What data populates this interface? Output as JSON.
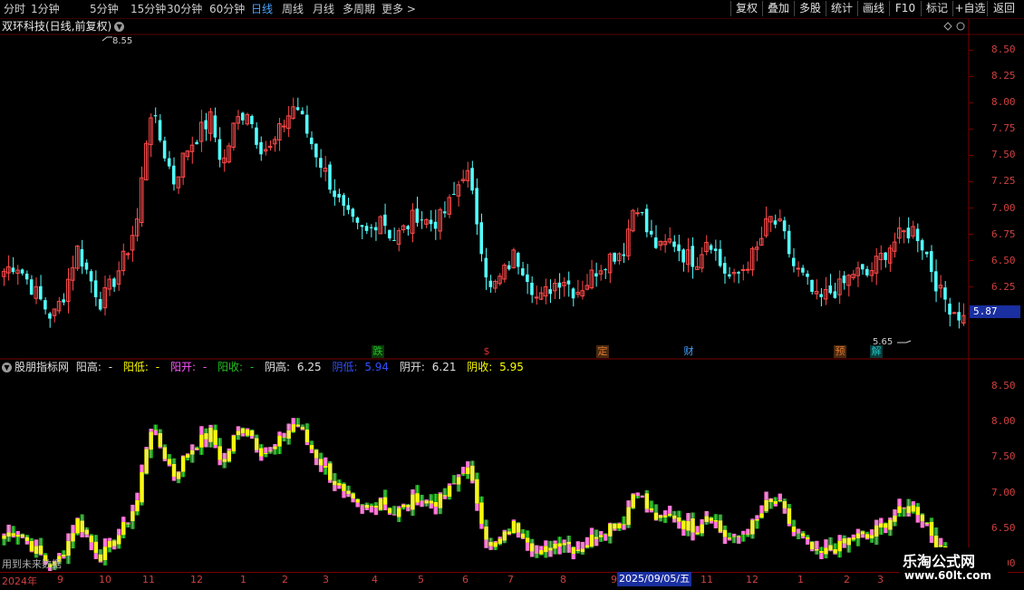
{
  "toolbar": {
    "periods": [
      "分时",
      "1分钟",
      "5分钟",
      "15分钟",
      "30分钟",
      "60分钟",
      "日线",
      "周线",
      "月线",
      "多周期",
      "更多 >"
    ],
    "active_period": "日线",
    "buttons": [
      "复权",
      "叠加",
      "多股",
      "统计",
      "画线",
      "F10",
      "标记",
      "+自选",
      "返回"
    ]
  },
  "main_chart": {
    "title": "双环科技(日线,前复权)",
    "y_ticks": [
      "8.50",
      "8.25",
      "8.00",
      "7.75",
      "7.50",
      "7.25",
      "7.00",
      "6.75",
      "6.50",
      "6.25",
      "6.00"
    ],
    "current_price": "5.87",
    "high_label": "8.55",
    "low_label": "5.65",
    "events": [
      {
        "text": "跌",
        "color": "#22c022"
      },
      {
        "text": "$",
        "color": "#e03030"
      },
      {
        "text": "定",
        "color": "#e07830"
      },
      {
        "text": "财",
        "color": "#4aa3ff"
      },
      {
        "text": "预",
        "color": "#e07830"
      },
      {
        "text": "解",
        "color": "#22c0c0"
      }
    ]
  },
  "indicator": {
    "name": "股朋指标网",
    "items": [
      {
        "label": "阳高:",
        "value": "-",
        "color": "#e0e0e0"
      },
      {
        "label": "阳低:",
        "value": "-",
        "color": "#ffff00"
      },
      {
        "label": "阳开:",
        "value": "-",
        "color": "#ff55ff"
      },
      {
        "label": "阳收:",
        "value": "-",
        "color": "#22c022"
      },
      {
        "label": "阴高:",
        "value": "6.25",
        "color": "#e0e0e0"
      },
      {
        "label": "阴低:",
        "value": "5.94",
        "color": "#3050ff"
      },
      {
        "label": "阴开:",
        "value": "6.21",
        "color": "#e0e0e0"
      },
      {
        "label": "阴收:",
        "value": "5.95",
        "color": "#ffff00"
      }
    ],
    "y_ticks": [
      "8.50",
      "8.00",
      "7.50",
      "7.00",
      "6.50",
      "6.00"
    ],
    "future_note": "用到未来数据"
  },
  "date_axis": {
    "labels": [
      "2024年",
      "9",
      "10",
      "11",
      "12",
      "1",
      "2",
      "3",
      "4",
      "5",
      "6",
      "7",
      "8",
      "9",
      "10",
      "11",
      "12",
      "1",
      "2",
      "3"
    ],
    "highlight": "2025/09/05/五"
  },
  "watermark": {
    "line1": "乐淘公式网",
    "line2": "www.60lt.com"
  },
  "chart_data": {
    "type": "candlestick",
    "title": "双环科技(日线,前复权)",
    "series_close": [
      6.4,
      6.48,
      6.3,
      6.12,
      5.95,
      6.2,
      6.62,
      6.35,
      6.1,
      6.3,
      6.55,
      6.9,
      7.95,
      7.6,
      7.25,
      7.55,
      7.7,
      7.85,
      7.4,
      7.8,
      7.95,
      7.6,
      7.55,
      7.8,
      8.0,
      7.7,
      7.45,
      7.2,
      6.95,
      6.8,
      6.75,
      6.95,
      6.7,
      6.8,
      6.95,
      6.85,
      6.9,
      7.1,
      7.4,
      6.85,
      6.2,
      6.35,
      6.55,
      6.4,
      6.1,
      6.25,
      6.35,
      6.2,
      6.3,
      6.45,
      6.55,
      6.6,
      7.1,
      6.75,
      6.6,
      6.7,
      6.55,
      6.5,
      6.75,
      6.45,
      6.3,
      6.45,
      6.6,
      6.9,
      6.8,
      6.45,
      6.3,
      6.1,
      6.2,
      6.25,
      6.4,
      6.35,
      6.5,
      6.65,
      6.75,
      6.8,
      6.55,
      6.2,
      6.05,
      5.95
    ],
    "ylim": [
      5.6,
      8.65
    ],
    "high": 8.55,
    "low": 5.65,
    "last": 5.87
  }
}
